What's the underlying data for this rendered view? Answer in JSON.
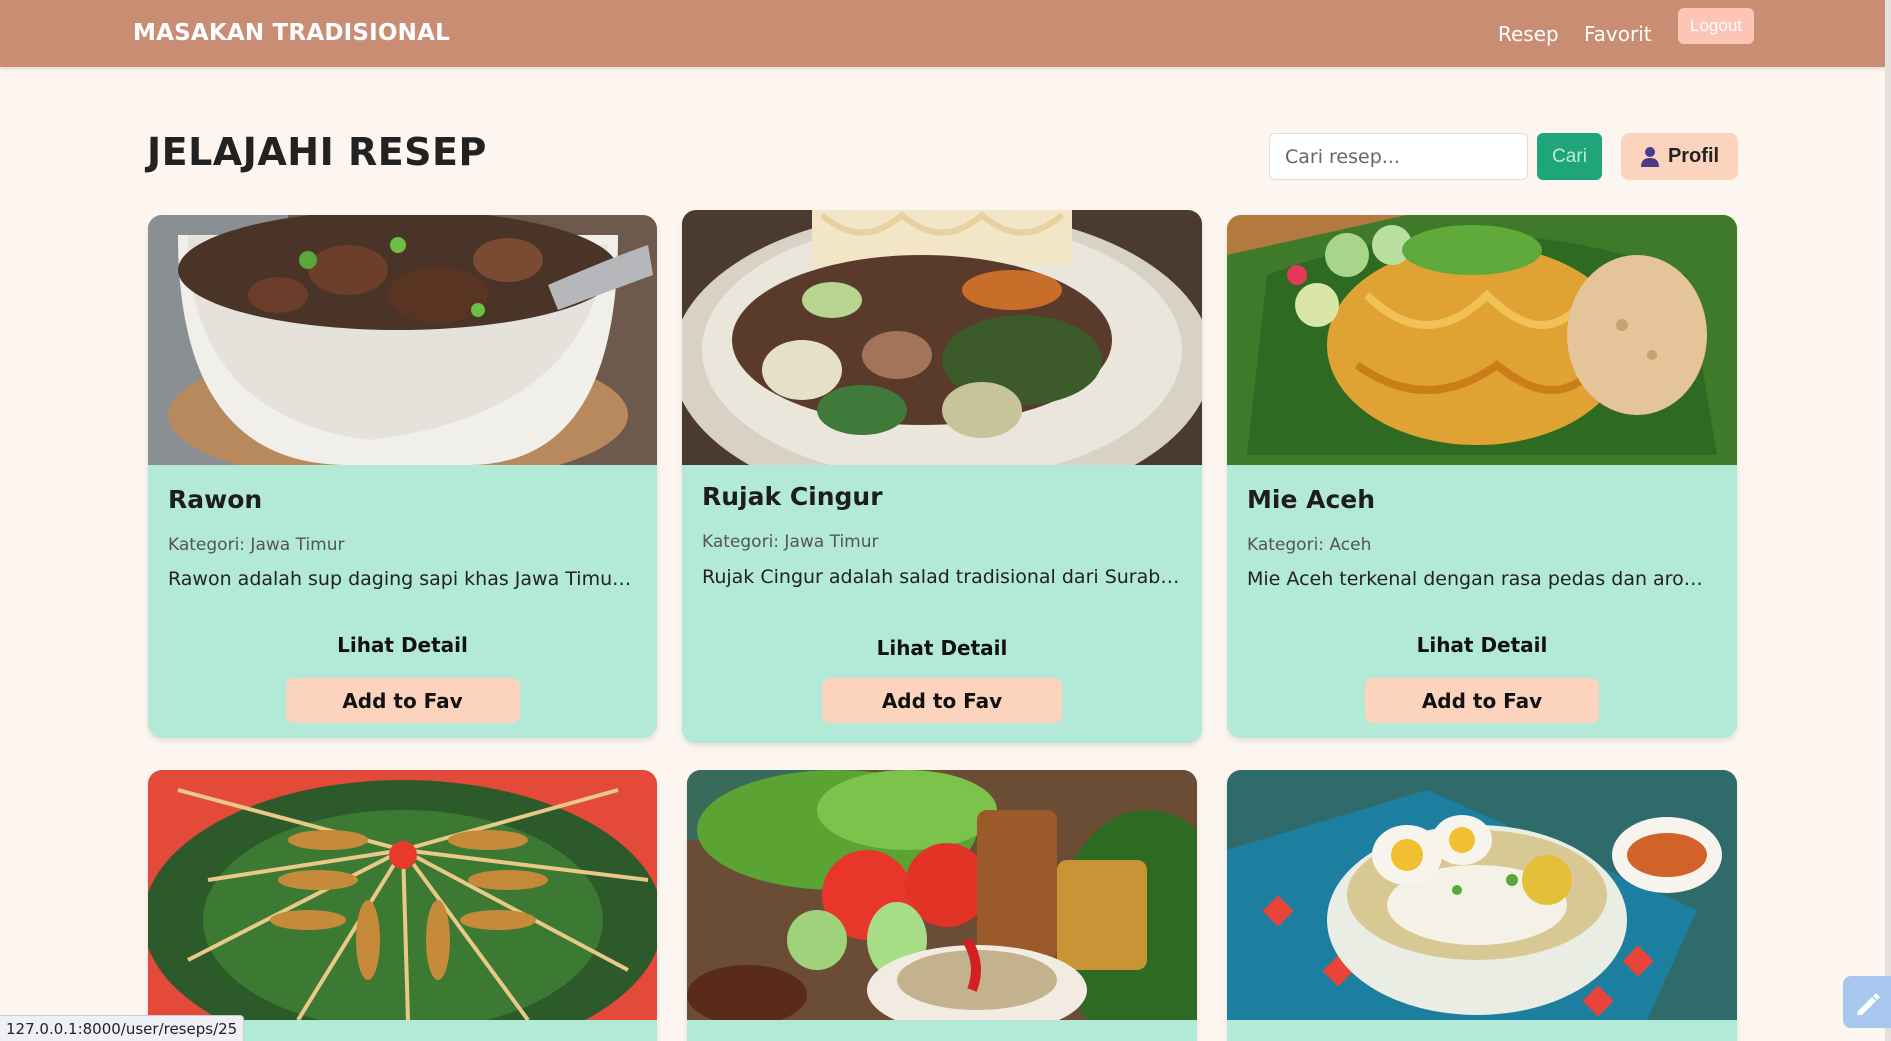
{
  "navbar": {
    "brand": "MASAKAN TRADISIONAL",
    "links": [
      "Resep",
      "Favorit"
    ],
    "logout_label": "Logout",
    "bg_color": "#c98d74"
  },
  "header": {
    "title": "JELAJAHI RESEP",
    "search_placeholder": "Cari resep...",
    "search_button": "Cari",
    "profile_button": "Profil"
  },
  "cards": [
    {
      "title": "Rawon",
      "category": "Kategori: Jawa Timur",
      "description": "Rawon adalah sup daging sapi khas Jawa Timur yan...",
      "detail_label": "Lihat Detail",
      "fav_label": "Add to Fav",
      "image": "rawon-photo"
    },
    {
      "title": "Rujak Cingur",
      "category": "Kategori: Jawa Timur",
      "description": "Rujak Cingur adalah salad tradisional dari Surabaya...",
      "detail_label": "Lihat Detail",
      "fav_label": "Add to Fav",
      "image": "rujak-cingur-photo"
    },
    {
      "title": "Mie Aceh",
      "category": "Kategori: Aceh",
      "description": "Mie Aceh terkenal dengan rasa pedas dan aroma re...",
      "detail_label": "Lihat Detail",
      "fav_label": "Add to Fav",
      "image": "mie-aceh-photo"
    },
    {
      "image": "sate-photo"
    },
    {
      "image": "nasi-pecel-photo"
    },
    {
      "image": "soto-photo"
    }
  ],
  "status_bar": {
    "url": "127.0.0.1:8000/user/reseps/25"
  },
  "colors": {
    "card_bg": "#b3e9d7",
    "fav_button": "#fcd3bd",
    "search_button": "#1fa57a",
    "page_bg": "#fdf6f0"
  }
}
